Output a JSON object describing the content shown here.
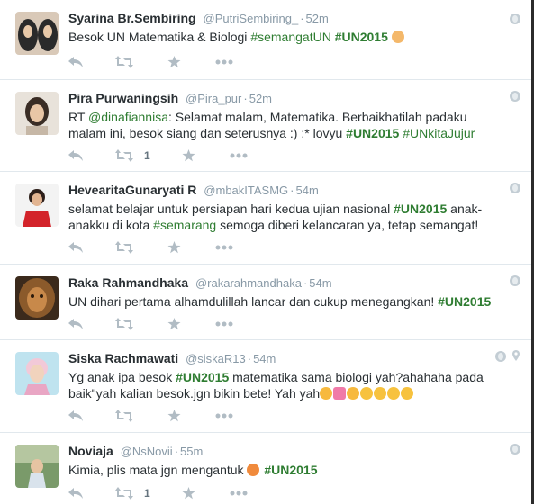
{
  "tweets": [
    {
      "name": "Syarina Br.Sembiring",
      "handle": "@PutriSembiring_",
      "time": "52m",
      "text_parts": [
        "Besok UN Matematika & Biologi "
      ],
      "tags": [
        "#semangatUN",
        "#UN2015"
      ],
      "retweets": ""
    },
    {
      "name": "Pira Purwaningsih",
      "handle": "@Pira_pur",
      "time": "52m",
      "prefix": "RT ",
      "mention": "@dinafiannisa",
      "text": ": Selamat malam, Matematika. Berbaikhatilah padaku malam ini, besok siang dan seterusnya :) :* lovyu ",
      "tags": [
        "#UN2015",
        "#UNkitaJujur"
      ],
      "retweets": "1"
    },
    {
      "name": "HevearitaGunaryati R",
      "handle": "@mbakITASMG",
      "time": "54m",
      "text1": "selamat belajar untuk persiapan hari kedua ujian nasional ",
      "tag1": "#UN2015",
      "text2": " anak-anakku di kota ",
      "tag2": "#semarang",
      "text3": " semoga diberi kelancaran ya, tetap semangat!",
      "retweets": ""
    },
    {
      "name": "Raka Rahmandhaka",
      "handle": "@rakarahmandhaka",
      "time": "54m",
      "text": "UN dihari pertama alhamdulillah lancar dan cukup menegangkan! ",
      "tag": "#UN2015",
      "retweets": ""
    },
    {
      "name": "Siska Rachmawati",
      "handle": "@siskaR13",
      "time": "54m",
      "text1": "Yg anak ipa besok ",
      "tag": "#UN2015",
      "text2": "  matematika sama biologi yah?ahahaha pada baik\"yah kalian besok.jgn bikin bete! Yah yah",
      "retweets": ""
    },
    {
      "name": "Noviaja",
      "handle": "@NsNovii",
      "time": "55m",
      "text": "Kimia, plis mata jgn mengantuk ",
      "tag": "#UN2015",
      "retweets": "1"
    }
  ],
  "colors": {
    "hashtag": "#2f7d32",
    "handle": "#8899a6",
    "icon": "#b1bcc4",
    "border": "#e1e8ed"
  },
  "icons": [
    "reply-icon",
    "retweet-icon",
    "favorite-icon",
    "more-icon",
    "globe-icon",
    "location-pin-icon"
  ]
}
